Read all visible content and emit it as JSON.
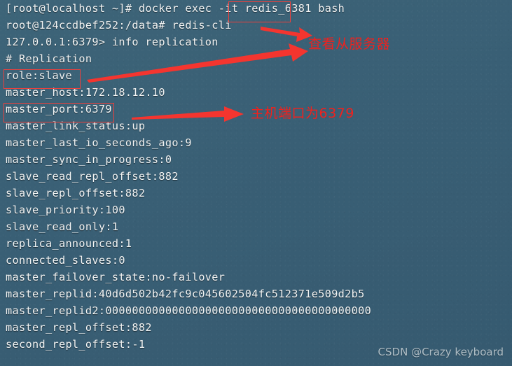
{
  "terminal": {
    "background_color": "#3a6076",
    "text_color": "#f2f4f4",
    "lines": [
      {
        "text": "[root@localhost ~]# docker exec -it redis_6381 bash"
      },
      {
        "text": "root@124ccdbef252:/data# redis-cli"
      },
      {
        "text": "127.0.0.1:6379> info replication"
      },
      {
        "text": "# Replication"
      },
      {
        "text": "role:slave"
      },
      {
        "text": "master_host:172.18.12.10"
      },
      {
        "text": "master_port:6379"
      },
      {
        "text": "master_link_status:up"
      },
      {
        "text": "master_last_io_seconds_ago:9"
      },
      {
        "text": "master_sync_in_progress:0"
      },
      {
        "text": "slave_read_repl_offset:882"
      },
      {
        "text": "slave_repl_offset:882"
      },
      {
        "text": "slave_priority:100"
      },
      {
        "text": "slave_read_only:1"
      },
      {
        "text": "replica_announced:1"
      },
      {
        "text": "connected_slaves:0"
      },
      {
        "text": "master_failover_state:no-failover"
      },
      {
        "text": "master_replid:40d6d502b42fc9c045602504fc512371e509d2b5"
      },
      {
        "text": "master_replid2:0000000000000000000000000000000000000000"
      },
      {
        "text": "master_repl_offset:882"
      },
      {
        "text": "second_repl_offset:-1"
      }
    ]
  },
  "annotations": {
    "accent_color": "#f0403c",
    "highlight_boxes": [
      {
        "label": "container-name-highlight",
        "target": "redis_6381"
      },
      {
        "label": "role-slave-highlight",
        "target": "role:slave"
      },
      {
        "label": "master-port-highlight",
        "target": "master_port:6379"
      }
    ],
    "notes": [
      {
        "label": "view-slave-server-note",
        "text": "查看从服务器"
      },
      {
        "label": "master-port-note",
        "text": "主机端口为6379"
      }
    ]
  },
  "watermark": {
    "text": "CSDN @Crazy keyboard"
  }
}
